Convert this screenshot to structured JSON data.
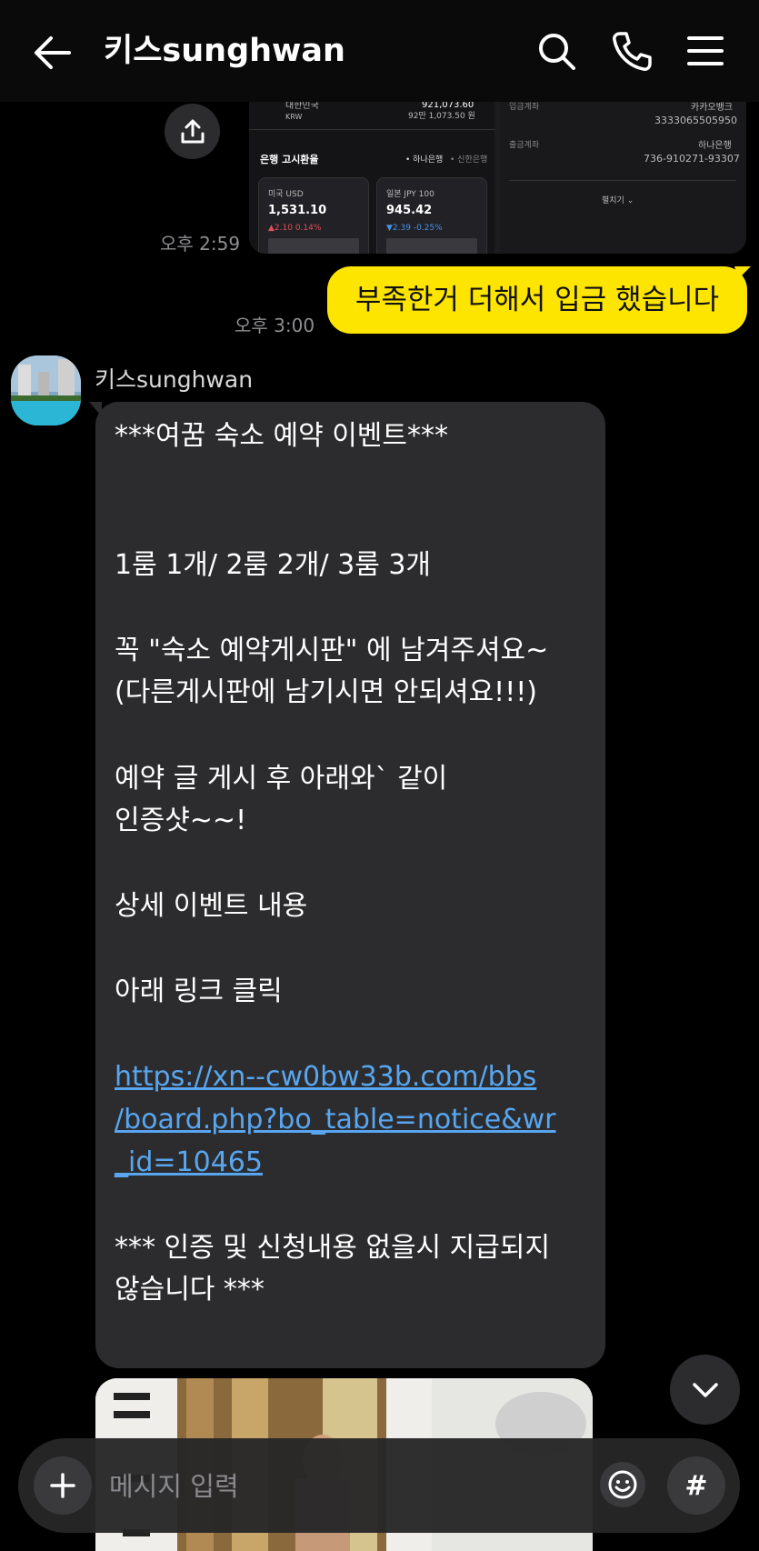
{
  "header": {
    "title": "키스sunghwan",
    "icons": [
      "back-arrow-icon",
      "search-icon",
      "phone-icon",
      "menu-icon"
    ]
  },
  "shared_screenshot": {
    "currency_row": {
      "currency": "KRW",
      "amount_line": "921,073.60",
      "amount_sub": "92만 1,073.50 원",
      "label": "대한민국"
    },
    "section_title": "은행 고시환율",
    "bank_tabs": [
      "• 하나은행",
      "• 신한은행"
    ],
    "usd": {
      "name": "미국 USD",
      "value": "1,531.10",
      "change": "▲2.10 0.14%"
    },
    "jpy": {
      "name": "일본 JPY 100",
      "value": "945.42",
      "change": "▼2.39 -0.25%"
    },
    "deposit_label": "입금계좌",
    "deposit_bank": "카카오뱅크",
    "deposit_account": "3333065505950",
    "withdraw_label": "출금계좌",
    "withdraw_bank": "하나은행",
    "withdraw_account": "736-910271-93307",
    "expand_label": "펼치기 ⌄"
  },
  "messages": {
    "time_1": "오후 2:59",
    "outgoing_text": "부족한거 더해서 입금 했습니다",
    "time_2": "오후 3:00",
    "sender_name": "키스sunghwan",
    "incoming_lines": [
      "***여꿈 숙소 예약 이벤트***",
      "1룸 1개/ 2룸 2개/ 3룸 3개",
      "꼭  \"숙소 예약게시판\" 에 남겨주셔요~",
      "(다른게시판에 남기시면 안되셔요!!!)",
      "예약 글 게시 후 아래와` 같이",
      "인증샷~~!",
      "상세 이벤트 내용",
      "아래 링크 클릭"
    ],
    "link_lines": [
      "https://xn--cw0bw33b.com/bbs",
      "/board.php?bo_table=notice&wr",
      "_id=10465"
    ],
    "footer_lines": [
      "*** 인증 및 신청내용 없을시 지급되지",
      "않습니다 ***"
    ]
  },
  "composer": {
    "placeholder": "메시지 입력",
    "hash_label": "#"
  },
  "colors": {
    "background": "#000000",
    "outgoing_bubble": "#fee500",
    "incoming_bubble": "#2c2c2e",
    "link": "#58a6ef"
  }
}
